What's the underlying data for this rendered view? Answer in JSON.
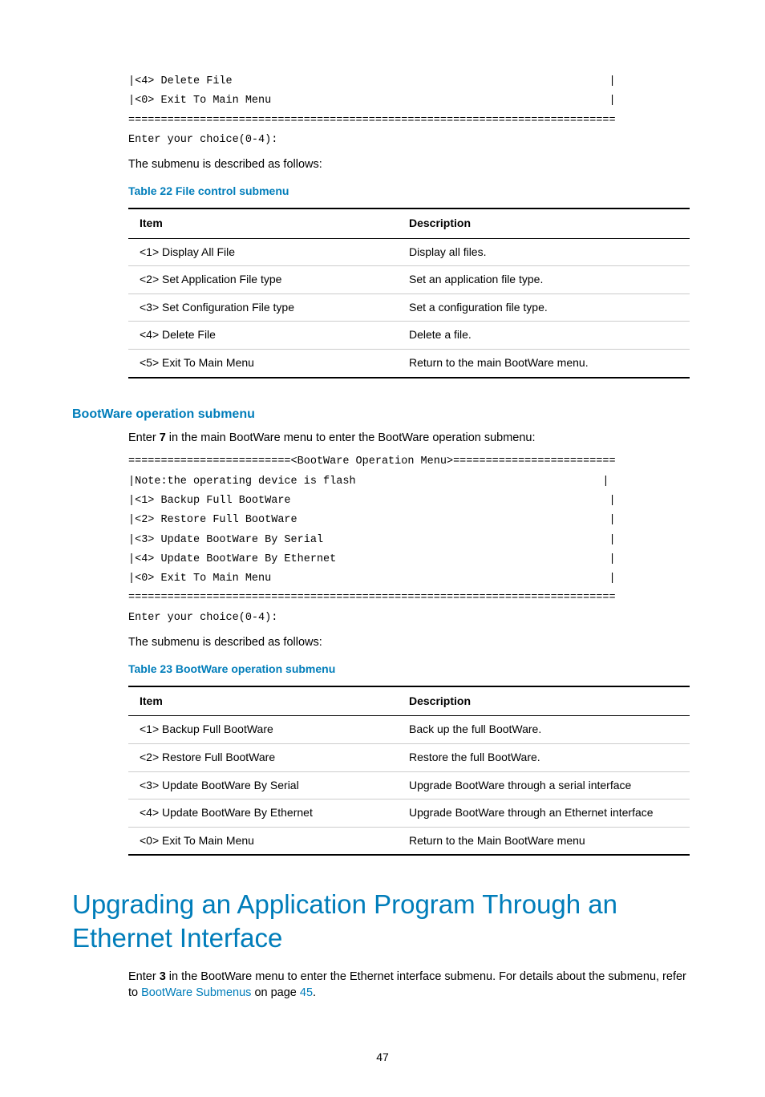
{
  "code1": {
    "l1": "|<4> Delete File                                                          |",
    "l2": "|<0> Exit To Main Menu                                                    |",
    "l3": "===========================================================================",
    "l4": "Enter your choice(0-4):"
  },
  "para1": "The submenu is described as follows:",
  "table22_caption": "Table 22 File control submenu",
  "table_headers": {
    "item": "Item",
    "desc": "Description"
  },
  "table22": [
    {
      "item": "<1> Display All File",
      "desc": "Display all files."
    },
    {
      "item": "<2> Set Application File type",
      "desc": "Set an application file type."
    },
    {
      "item": "<3> Set Configuration File type",
      "desc": "Set a configuration file type."
    },
    {
      "item": "<4> Delete File",
      "desc": "Delete a file."
    },
    {
      "item": "<5> Exit To Main Menu",
      "desc": "Return to the main BootWare menu."
    }
  ],
  "section2_heading": "BootWare operation submenu",
  "para2_pre": "Enter ",
  "para2_bold": "7",
  "para2_post": " in the main BootWare menu to enter the BootWare operation submenu:",
  "code2": {
    "l1": "=========================<BootWare Operation Menu>=========================",
    "l2": "|Note:the operating device is flash                                      |",
    "l3": "|<1> Backup Full BootWare                                                 |",
    "l4": "|<2> Restore Full BootWare                                                |",
    "l5": "|<3> Update BootWare By Serial                                            |",
    "l6": "|<4> Update BootWare By Ethernet                                          |",
    "l7": "|<0> Exit To Main Menu                                                    |",
    "l8": "===========================================================================",
    "l9": "Enter your choice(0-4):"
  },
  "para3": "The submenu is described as follows:",
  "table23_caption": "Table 23 BootWare operation submenu",
  "table23": [
    {
      "item": "<1> Backup Full BootWare",
      "desc": "Back up the full BootWare."
    },
    {
      "item": "<2> Restore Full BootWare",
      "desc": "Restore the full BootWare."
    },
    {
      "item": "<3> Update BootWare By Serial",
      "desc": "Upgrade BootWare through a serial interface"
    },
    {
      "item": "<4> Update BootWare By Ethernet",
      "desc": "Upgrade BootWare through an Ethernet interface"
    },
    {
      "item": "<0> Exit To Main Menu",
      "desc": "Return to the Main BootWare menu"
    }
  ],
  "main_heading": "Upgrading an Application Program Through an Ethernet Interface",
  "para4_pre": "Enter ",
  "para4_bold": "3",
  "para4_mid": " in the BootWare menu to enter the Ethernet interface submenu. For details about the submenu, refer to ",
  "para4_link1": "BootWare Submenus",
  "para4_onpage": " on page ",
  "para4_link2": "45",
  "para4_end": ".",
  "page_number": "47"
}
